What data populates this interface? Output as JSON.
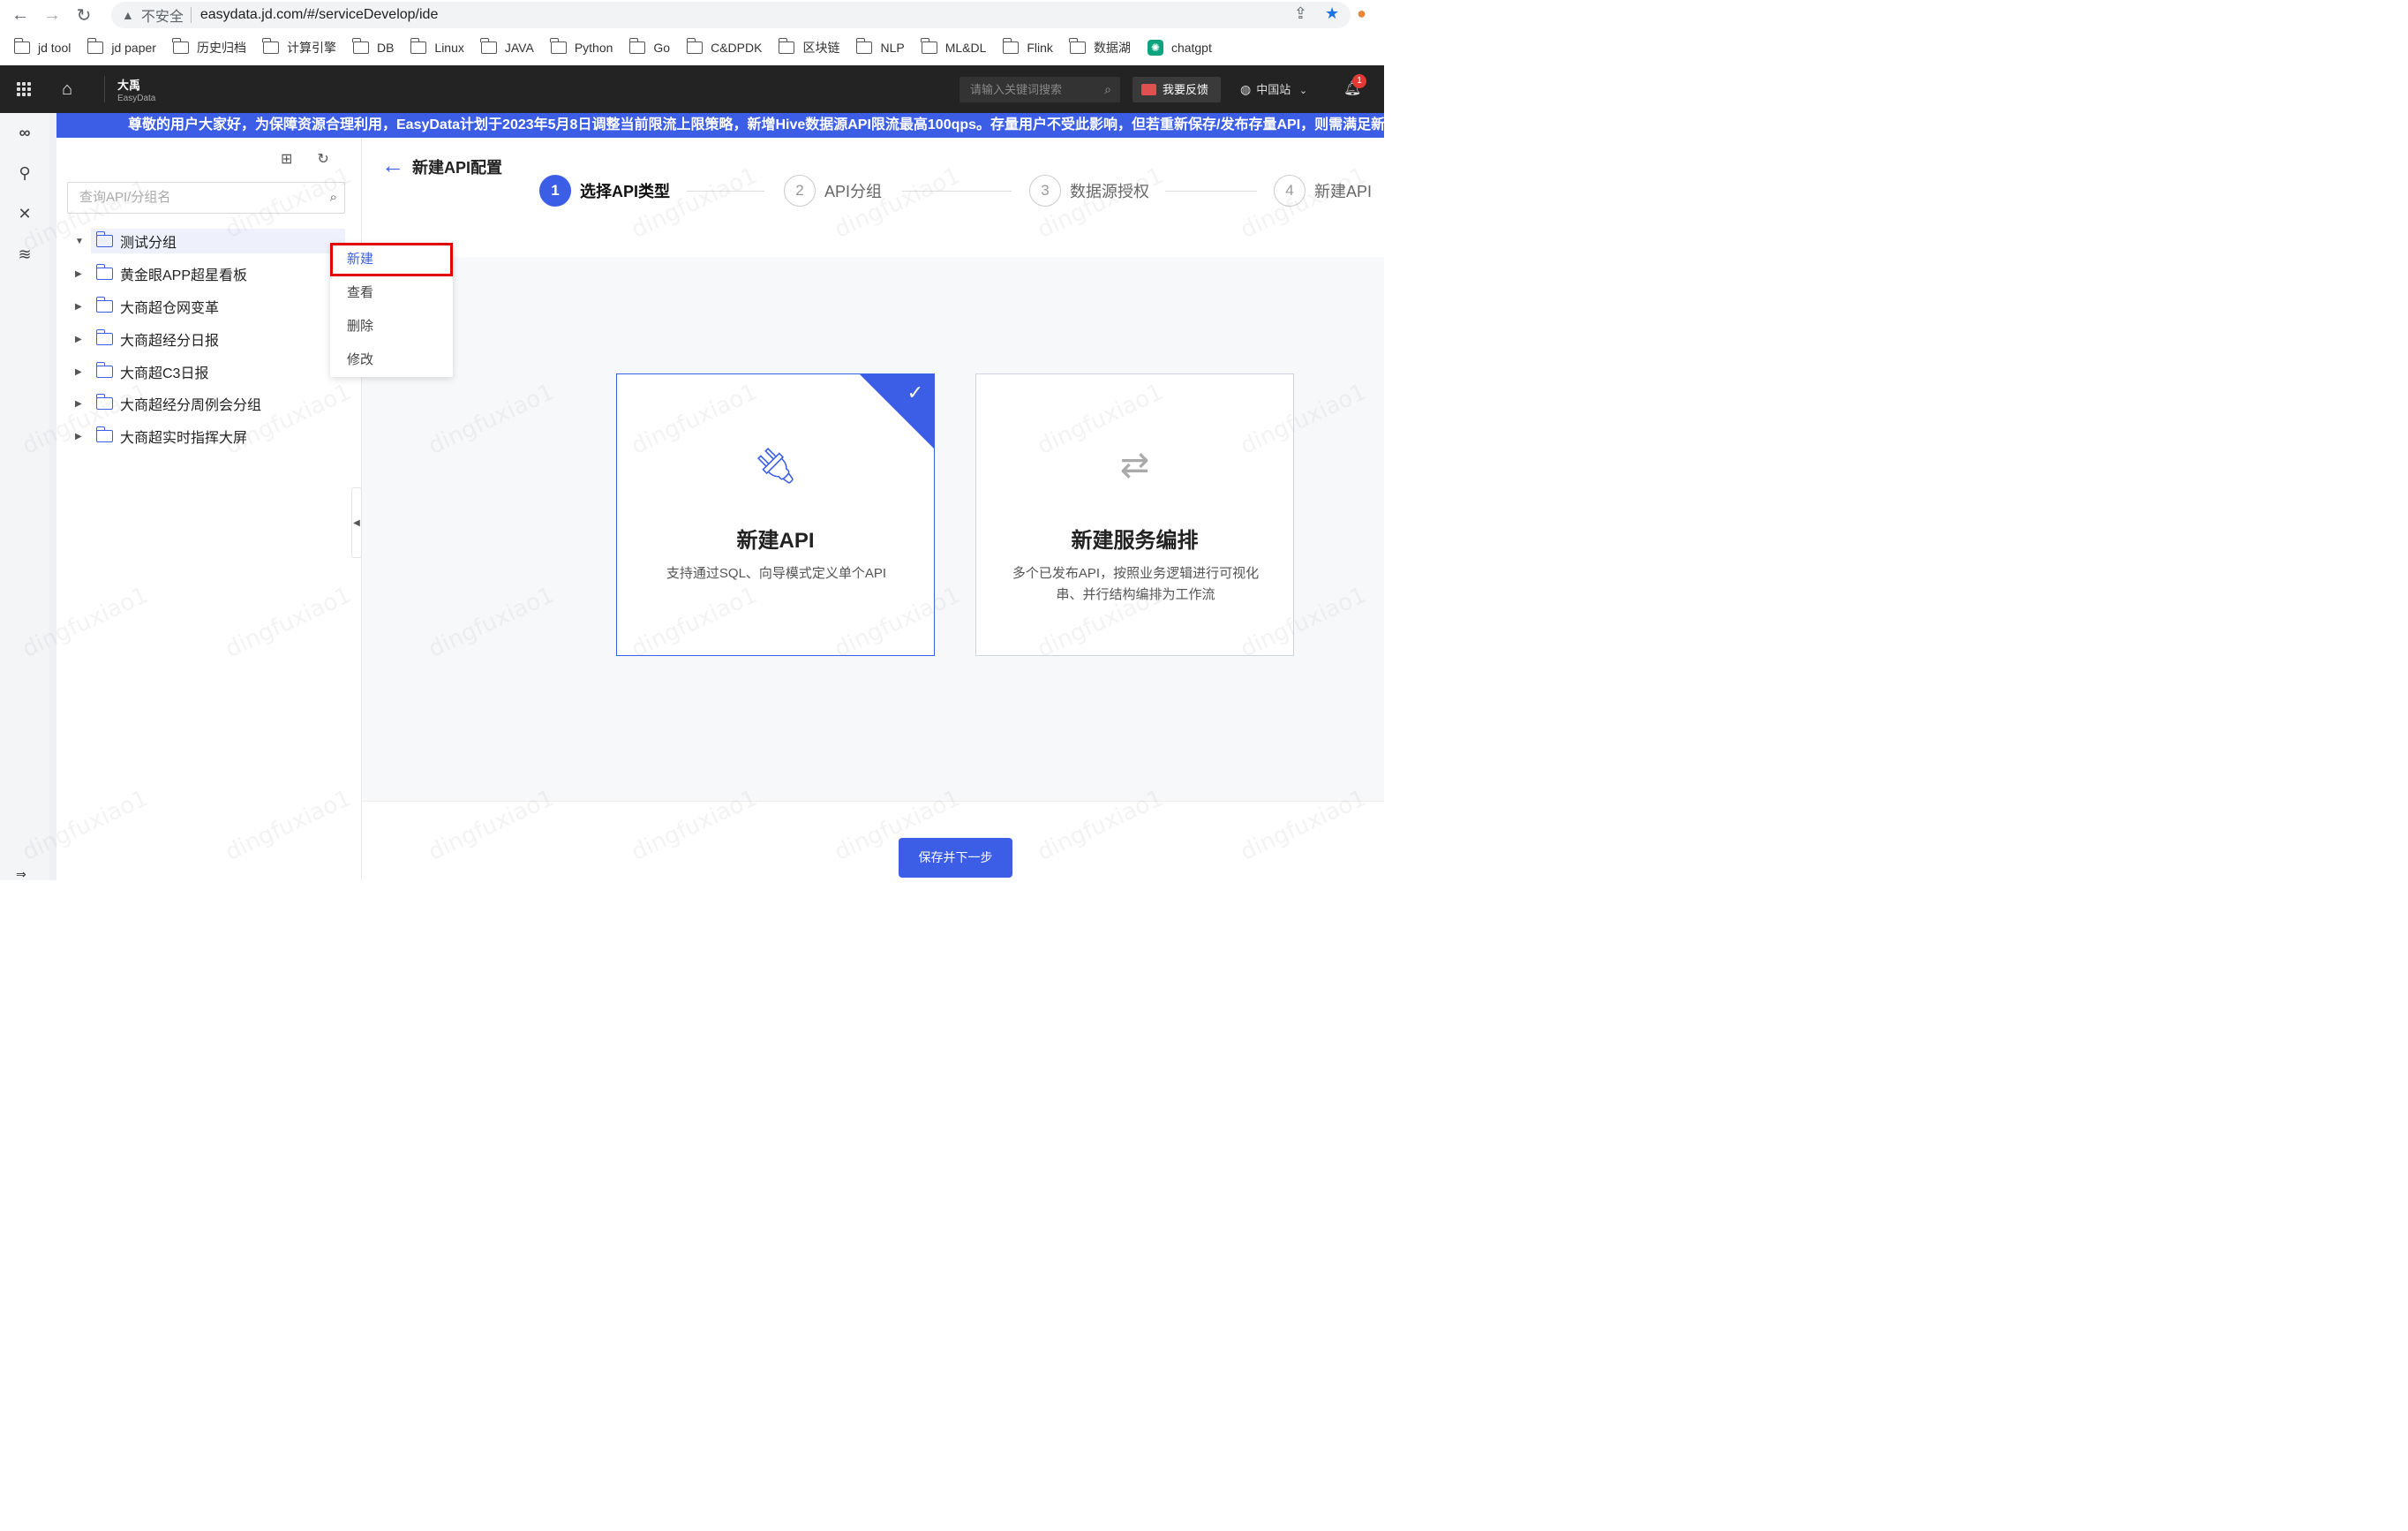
{
  "browser": {
    "security_label": "不安全",
    "url": "easydata.jd.com/#/serviceDevelop/ide",
    "bookmarks": [
      "jd tool",
      "jd paper",
      "历史归档",
      "计算引擎",
      "DB",
      "Linux",
      "JAVA",
      "Python",
      "Go",
      "C&DPDK",
      "区块链",
      "NLP",
      "ML&DL",
      "Flink",
      "数据湖"
    ],
    "bookmark_chatgpt": "chatgpt"
  },
  "topbar": {
    "brand_cn": "大禹",
    "brand_en": "EasyData",
    "search_placeholder": "请输入关键词搜索",
    "feedback_label": "我要反馈",
    "region_label": "中国站",
    "notification_count": "1"
  },
  "notice": "尊敬的用户大家好，为保障资源合理利用，EasyData计划于2023年5月8日调整当前限流上限策略，新增Hive数据源API限流最高100qps。存量用户不受此影响，但若重新保存/发布存量API，则需满足新",
  "tree": {
    "search_placeholder": "查询API/分组名",
    "items": [
      "测试分组",
      "黄金眼APP超星看板",
      "大商超仓网变革",
      "大商超经分日报",
      "大商超C3日报",
      "大商超经分周例会分组",
      "大商超实时指挥大屏"
    ]
  },
  "context_menu": [
    "新建",
    "查看",
    "删除",
    "修改"
  ],
  "main": {
    "title": "新建API配置",
    "steps": [
      {
        "num": "1",
        "label": "选择API类型"
      },
      {
        "num": "2",
        "label": "API分组"
      },
      {
        "num": "3",
        "label": "数据源授权"
      },
      {
        "num": "4",
        "label": "新建API"
      }
    ],
    "cards": [
      {
        "title": "新建API",
        "desc": "支持通过SQL、向导模式定义单个API"
      },
      {
        "title": "新建服务编排",
        "desc": "多个已发布API，按照业务逻辑进行可视化串、并行结构编排为工作流"
      }
    ],
    "next_button": "保存并下一步"
  },
  "watermark_text": "dingfuxiao1",
  "colors": {
    "accent": "#3c5ee6",
    "header_bg": "#232323",
    "highlight_border": "#e00000"
  }
}
